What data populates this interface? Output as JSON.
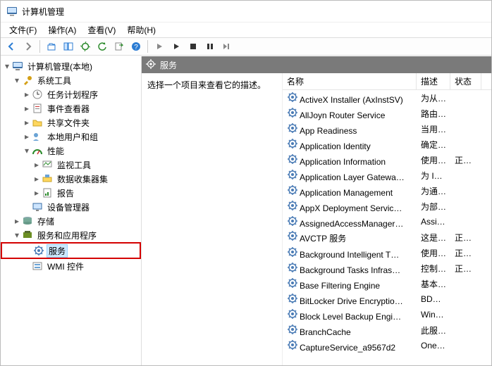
{
  "title": "计算机管理",
  "menus": [
    "文件(F)",
    "操作(A)",
    "查看(V)",
    "帮助(H)"
  ],
  "toolbar_icons": [
    "back-icon",
    "forward-icon",
    "up-icon",
    "show-hide-tree-icon",
    "properties-icon",
    "refresh-icon",
    "export-icon",
    "help-icon",
    "sep",
    "play-icon",
    "stop-icon",
    "pause-icon",
    "restart-icon"
  ],
  "tree": {
    "root": {
      "label": "计算机管理(本地)",
      "icon": "computer-icon"
    },
    "system_tools": {
      "label": "系统工具",
      "icon": "tools-icon",
      "children": [
        {
          "key": "task-scheduler",
          "label": "任务计划程序",
          "icon": "clock-icon",
          "expandable": true
        },
        {
          "key": "event-viewer",
          "label": "事件查看器",
          "icon": "event-icon",
          "expandable": true
        },
        {
          "key": "shared-folders",
          "label": "共享文件夹",
          "icon": "folder-share-icon",
          "expandable": true
        },
        {
          "key": "local-users",
          "label": "本地用户和组",
          "icon": "users-icon",
          "expandable": true
        },
        {
          "key": "performance",
          "label": "性能",
          "icon": "perf-icon",
          "expanded": true,
          "children": [
            {
              "key": "monitor-tools",
              "label": "监视工具",
              "icon": "monitor-icon",
              "expandable": true
            },
            {
              "key": "data-collector",
              "label": "数据收集器集",
              "icon": "collector-icon",
              "expandable": true
            },
            {
              "key": "reports",
              "label": "报告",
              "icon": "report-icon",
              "expandable": true
            }
          ]
        },
        {
          "key": "device-manager",
          "label": "设备管理器",
          "icon": "device-icon"
        }
      ]
    },
    "storage": {
      "label": "存储",
      "icon": "storage-icon",
      "expandable": true
    },
    "services_apps": {
      "label": "服务和应用程序",
      "icon": "services-apps-icon",
      "expanded": true,
      "children": [
        {
          "key": "services",
          "label": "服务",
          "icon": "gear-icon",
          "selected": true,
          "highlight": true
        },
        {
          "key": "wmi",
          "label": "WMI 控件",
          "icon": "wmi-icon"
        }
      ]
    }
  },
  "detail": {
    "header_label": "服务",
    "description_hint": "选择一个项目来查看它的描述。",
    "columns": {
      "name": "名称",
      "desc": "描述",
      "status": "状态"
    },
    "services": [
      {
        "name": "ActiveX Installer (AxInstSV)",
        "desc": "为从…",
        "status": ""
      },
      {
        "name": "AllJoyn Router Service",
        "desc": "路由…",
        "status": ""
      },
      {
        "name": "App Readiness",
        "desc": "当用…",
        "status": ""
      },
      {
        "name": "Application Identity",
        "desc": "确定…",
        "status": ""
      },
      {
        "name": "Application Information",
        "desc": "使用…",
        "status": "正在…"
      },
      {
        "name": "Application Layer Gatewa…",
        "desc": "为 In…",
        "status": ""
      },
      {
        "name": "Application Management",
        "desc": "为通…",
        "status": ""
      },
      {
        "name": "AppX Deployment Servic…",
        "desc": "为部…",
        "status": ""
      },
      {
        "name": "AssignedAccessManager…",
        "desc": "Assi…",
        "status": ""
      },
      {
        "name": "AVCTP 服务",
        "desc": "这是…",
        "status": "正在…"
      },
      {
        "name": "Background Intelligent T…",
        "desc": "使用…",
        "status": "正在…"
      },
      {
        "name": "Background Tasks Infras…",
        "desc": "控制…",
        "status": "正在…"
      },
      {
        "name": "Base Filtering Engine",
        "desc": "基本…",
        "status": ""
      },
      {
        "name": "BitLocker Drive Encryptio…",
        "desc": "BDE…",
        "status": ""
      },
      {
        "name": "Block Level Backup Engi…",
        "desc": "Win…",
        "status": ""
      },
      {
        "name": "BranchCache",
        "desc": "此服…",
        "status": ""
      },
      {
        "name": "CaptureService_a9567d2",
        "desc": "One…",
        "status": ""
      }
    ]
  }
}
